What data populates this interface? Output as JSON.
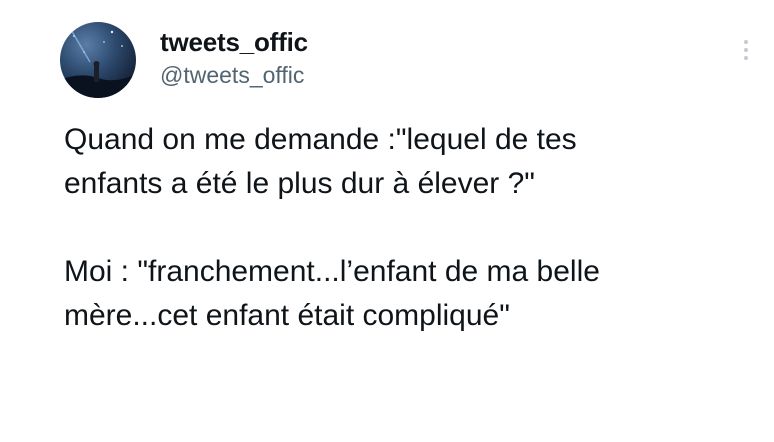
{
  "tweet": {
    "author": {
      "display_name": "tweets_offic",
      "handle": "@tweets_offic",
      "avatar_icon": "avatar-image"
    },
    "more_icon": "more-vertical-icon",
    "paragraphs": [
      "Quand on me demande :\"lequel de tes\nenfants a été le plus dur à élever ?\"",
      "Moi : \"franchement...l’enfant de ma belle\nmère...cet enfant était compliqué\""
    ]
  },
  "colors": {
    "text_primary": "#0f1419",
    "text_secondary": "#536471",
    "background": "#ffffff"
  }
}
